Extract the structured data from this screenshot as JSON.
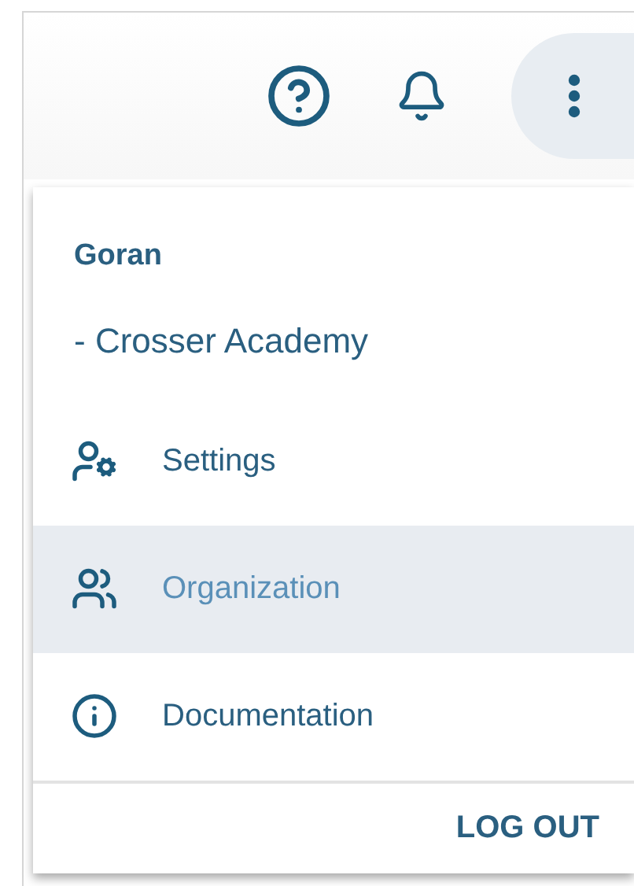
{
  "user": {
    "name": "Goran",
    "organization": "- Crosser Academy"
  },
  "menu_items": [
    {
      "label": "Settings",
      "selected": false
    },
    {
      "label": "Organization",
      "selected": true
    },
    {
      "label": "Documentation",
      "selected": false
    }
  ],
  "logout_button": "LOG OUT"
}
